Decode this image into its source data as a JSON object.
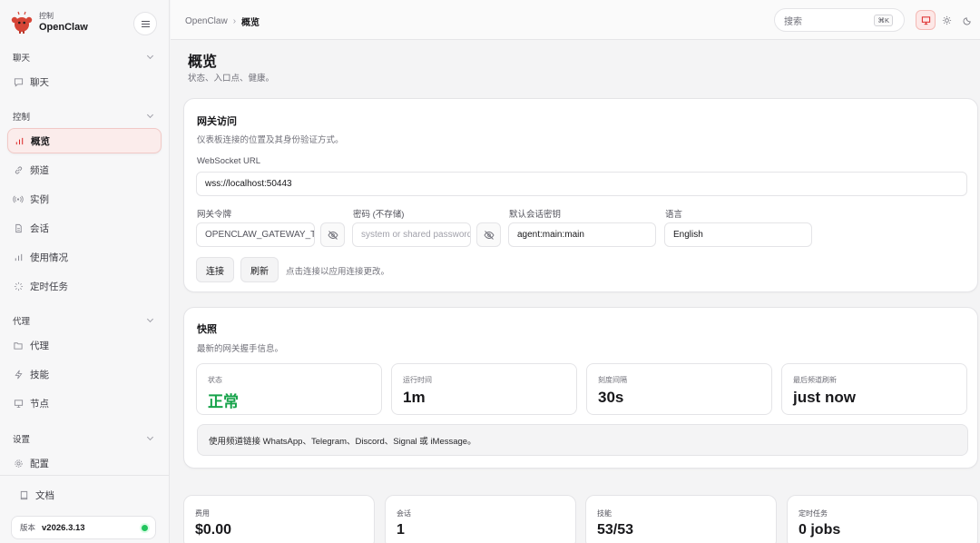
{
  "brand": {
    "sub": "控制",
    "name": "OpenClaw"
  },
  "sidebar": {
    "sections": [
      {
        "label": "聊天"
      },
      {
        "label": "控制"
      },
      {
        "label": "代理"
      },
      {
        "label": "设置"
      }
    ],
    "items": [
      {
        "label": "聊天",
        "icon": "chat-icon"
      },
      {
        "label": "概览",
        "icon": "bar-chart-icon",
        "active": true
      },
      {
        "label": "频道",
        "icon": "link-icon"
      },
      {
        "label": "实例",
        "icon": "radio-icon"
      },
      {
        "label": "会话",
        "icon": "document-icon"
      },
      {
        "label": "使用情况",
        "icon": "bar-chart-icon"
      },
      {
        "label": "定时任务",
        "icon": "loader-icon"
      },
      {
        "label": "代理",
        "icon": "folder-icon"
      },
      {
        "label": "技能",
        "icon": "zap-icon"
      },
      {
        "label": "节点",
        "icon": "monitor-icon"
      },
      {
        "label": "配置",
        "icon": "gear-icon"
      }
    ],
    "docs_label": "文档",
    "version_label": "版本",
    "version_value": "v2026.3.13",
    "status_color": "#22c55e"
  },
  "topbar": {
    "breadcrumb_root": "OpenClaw",
    "breadcrumb_sep": "›",
    "breadcrumb_current": "概览",
    "search_placeholder": "搜索",
    "search_shortcut": "⌘K"
  },
  "page": {
    "title": "概览",
    "subtitle": "状态、入口点、健康。"
  },
  "gateway": {
    "title": "网关访问",
    "subtitle": "仪表板连接的位置及其身份验证方式。",
    "ws_label": "WebSocket URL",
    "ws_value": "wss://localhost:50443",
    "token_label": "网关令牌",
    "token_value": "OPENCLAW_GATEWAY_TOKEN",
    "password_label": "密码 (不存储)",
    "password_placeholder": "system or shared password",
    "session_label": "默认会话密钥",
    "session_value": "agent:main:main",
    "language_label": "语言",
    "language_value": "English",
    "connect_label": "连接",
    "refresh_label": "刷新",
    "hint": "点击连接以应用连接更改。"
  },
  "snapshot": {
    "title": "快照",
    "subtitle": "最新的网关握手信息。",
    "stats": [
      {
        "key": "状态",
        "value": "正常",
        "ok": true
      },
      {
        "key": "运行时间",
        "value": "1m"
      },
      {
        "key": "刻度间隔",
        "value": "30s"
      },
      {
        "key": "最后频道刷新",
        "value": "just now"
      }
    ],
    "notice": "使用频道链接 WhatsApp、Telegram、Discord、Signal 或 iMessage。"
  },
  "metrics": [
    {
      "key": "费用",
      "value": "$0.00"
    },
    {
      "key": "会话",
      "value": "1"
    },
    {
      "key": "技能",
      "value": "53/53"
    },
    {
      "key": "定时任务",
      "value": "0 jobs"
    }
  ],
  "colors": {
    "accent": "#dc2626",
    "ok": "#16a34a"
  }
}
